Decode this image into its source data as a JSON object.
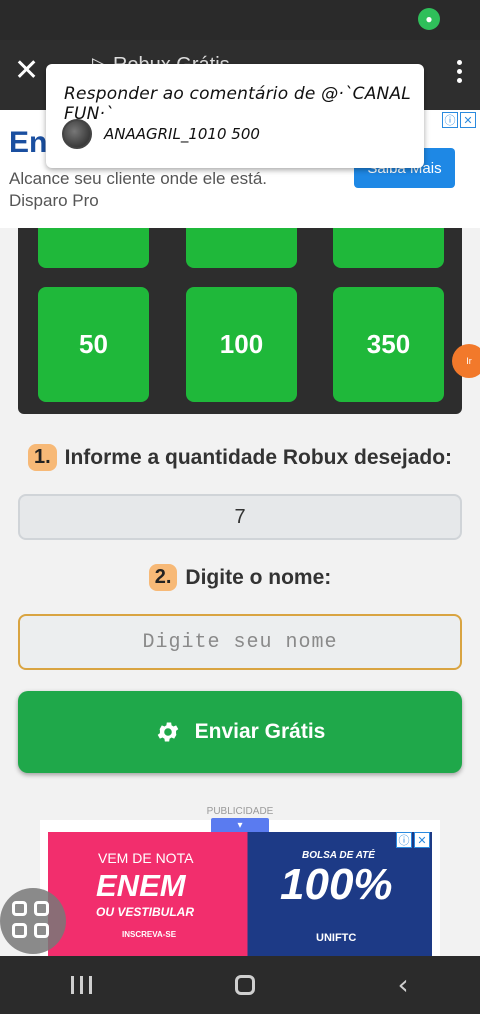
{
  "status": {
    "mic_icon": "mic-icon"
  },
  "browser": {
    "title": "▷ Robux Grátis",
    "close_glyph": "✕"
  },
  "reply_overlay": {
    "text": "Responder ao comentário de @·`CANAL FUN·`",
    "user": "ANAAGRIL_1010  500"
  },
  "top_ad": {
    "headline": "En",
    "description_line1": "Alcance seu cliente onde ele está.",
    "description_line2": "Disparo Pro",
    "cta": "Saiba Mais",
    "info_glyph": "ⓘ",
    "close_glyph": "✕"
  },
  "tiles": {
    "row_top": [
      "",
      "",
      ""
    ],
    "row_main": [
      "50",
      "100",
      "350"
    ]
  },
  "side_bubble": "Ir",
  "step1": {
    "badge": "1.",
    "label": "Informe a quantidade Robux desejado:"
  },
  "quantity_value": "7",
  "step2": {
    "badge": "2.",
    "label": "Digite o nome:"
  },
  "name_placeholder": "Digite seu nome",
  "send_button": {
    "label": "Enviar Grátis",
    "icon": "gear-icon"
  },
  "publicidade": "PUBLICIDADE",
  "banner": {
    "line1": "VEM DE NOTA",
    "line2": "ENEM",
    "line3": "OU VESTIBULAR",
    "cta": "INSCREVA-SE",
    "bolsa": "BOLSA DE ATÉ",
    "percent": "100%",
    "brand": "UNIFTC"
  },
  "colors": {
    "accent_green": "#1fb83a",
    "button_green": "#1fa84a",
    "badge_orange": "#f7b977",
    "ad_blue": "#1e88e5"
  }
}
